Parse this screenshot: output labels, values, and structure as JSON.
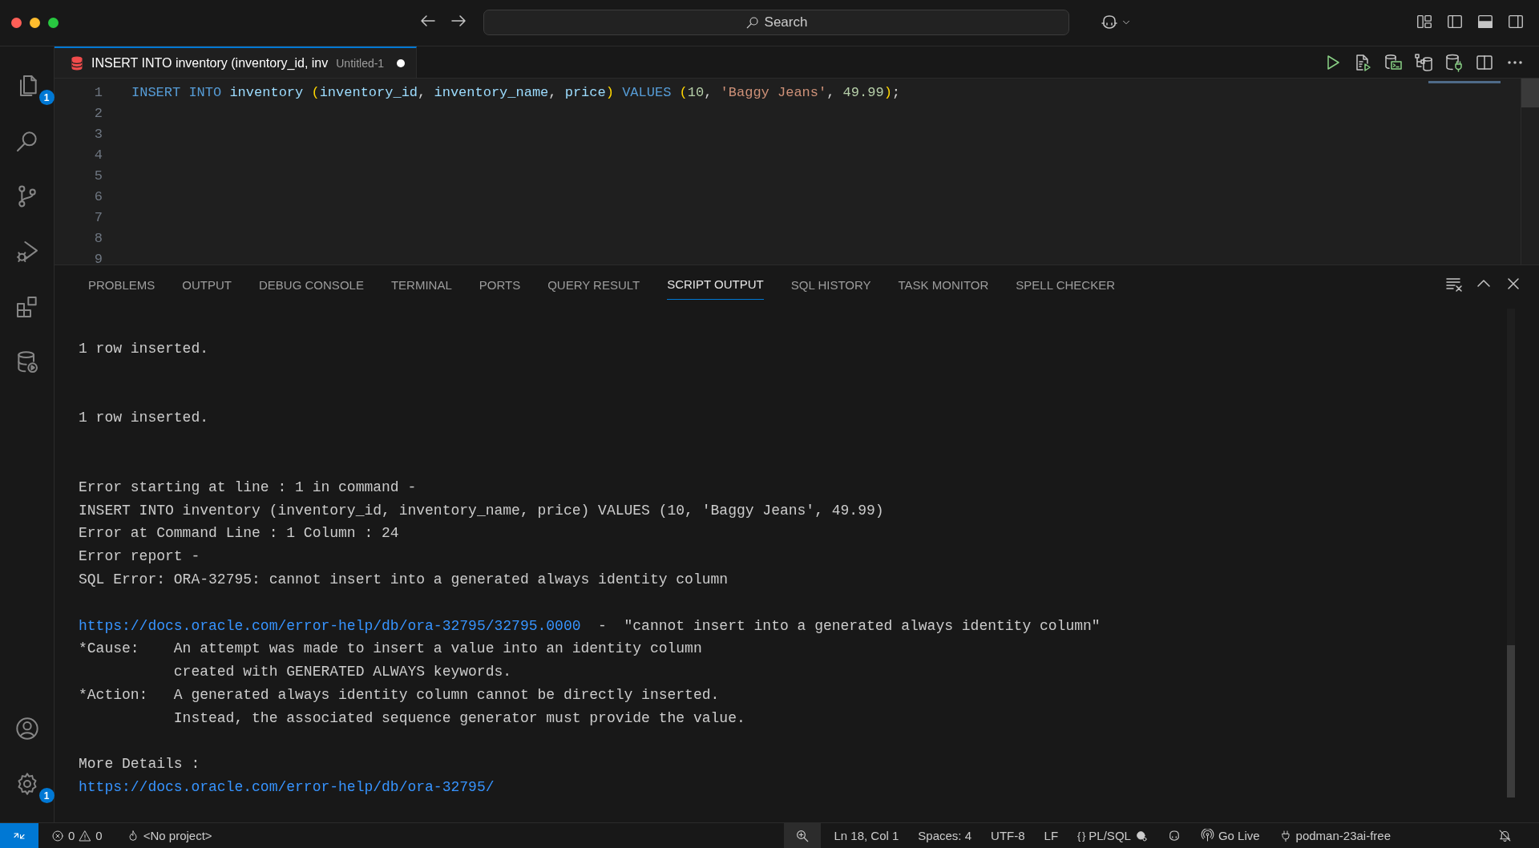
{
  "title_bar": {
    "command_center": "Search"
  },
  "activity_bar": {
    "items": [
      {
        "kind": "explorer",
        "badge": "1"
      },
      {
        "kind": "search"
      },
      {
        "kind": "source_control"
      },
      {
        "kind": "run_debug"
      },
      {
        "kind": "extensions"
      },
      {
        "kind": "database"
      }
    ],
    "bottom_items": [
      {
        "kind": "account"
      },
      {
        "kind": "settings",
        "badge": "1"
      }
    ]
  },
  "editor": {
    "tab": {
      "title": "INSERT INTO inventory (inventory_id, inv",
      "description": "Untitled-1",
      "dirty": true
    },
    "lines": [
      {
        "number": "1",
        "tokens": [
          {
            "kind": "keyword",
            "text": "INSERT INTO "
          },
          {
            "kind": "identifier",
            "text": "inventory "
          },
          {
            "kind": "bracket",
            "text": "("
          },
          {
            "kind": "identifier",
            "text": "inventory_id"
          },
          {
            "kind": "plain",
            "text": ", "
          },
          {
            "kind": "identifier",
            "text": "inventory_name"
          },
          {
            "kind": "plain",
            "text": ", "
          },
          {
            "kind": "identifier",
            "text": "price"
          },
          {
            "kind": "bracket",
            "text": ")"
          },
          {
            "kind": "keyword",
            "text": " VALUES "
          },
          {
            "kind": "bracket",
            "text": "("
          },
          {
            "kind": "number",
            "text": "10"
          },
          {
            "kind": "plain",
            "text": ", "
          },
          {
            "kind": "string",
            "text": "'Baggy Jeans'"
          },
          {
            "kind": "plain",
            "text": ", "
          },
          {
            "kind": "number",
            "text": "49.99"
          },
          {
            "kind": "bracket",
            "text": ")"
          },
          {
            "kind": "plain",
            "text": ";"
          }
        ]
      },
      {
        "number": "2"
      },
      {
        "number": "3"
      },
      {
        "number": "4"
      },
      {
        "number": "5"
      },
      {
        "number": "6"
      },
      {
        "number": "7"
      },
      {
        "number": "8"
      },
      {
        "number": "9"
      }
    ]
  },
  "panel": {
    "tabs": [
      {
        "label": "PROBLEMS",
        "selected": false
      },
      {
        "label": "OUTPUT",
        "selected": false
      },
      {
        "label": "DEBUG CONSOLE",
        "selected": false
      },
      {
        "label": "TERMINAL",
        "selected": false
      },
      {
        "label": "PORTS",
        "selected": false
      },
      {
        "label": "QUERY RESULT",
        "selected": false
      },
      {
        "label": "SCRIPT OUTPUT",
        "selected": true
      },
      {
        "label": "SQL HISTORY",
        "selected": false
      },
      {
        "label": "TASK MONITOR",
        "selected": false
      },
      {
        "label": "SPELL CHECKER",
        "selected": false
      }
    ],
    "output": [
      {
        "kind": "result",
        "lines": [
          {
            "kind": "text",
            "text": "1 row inserted."
          }
        ]
      },
      {
        "kind": "result",
        "lines": [
          {
            "kind": "text",
            "text": "1 row inserted."
          }
        ]
      },
      {
        "kind": "report",
        "lines": [
          {
            "kind": "text",
            "text": "Error starting at line : 1 in command -"
          },
          {
            "kind": "text",
            "text": "INSERT INTO inventory (inventory_id, inventory_name, price) VALUES (10, 'Baggy Jeans', 49.99)"
          },
          {
            "kind": "text",
            "text": "Error at Command Line : 1 Column : 24"
          },
          {
            "kind": "text",
            "text": "Error report -"
          },
          {
            "kind": "text",
            "text": "SQL Error: ORA-32795: cannot insert into a generated always identity column"
          }
        ]
      },
      {
        "kind": "report",
        "lines": [
          {
            "kind": "link",
            "link": "https://docs.oracle.com/error-help/db/ora-32795/32795.0000",
            "separator": "-",
            "text": "\"cannot insert into a generated always identity column\""
          },
          {
            "kind": "field",
            "label": "*Cause:",
            "text": "An attempt was made to insert a value into an identity column"
          },
          {
            "kind": "continuation",
            "text": "created with GENERATED ALWAYS keywords."
          },
          {
            "kind": "field",
            "label": "*Action:",
            "text": "A generated always identity column cannot be directly inserted."
          },
          {
            "kind": "continuation",
            "text": "Instead, the associated sequence generator must provide the value."
          }
        ]
      },
      {
        "kind": "report",
        "lines": [
          {
            "kind": "text",
            "text": "More Details :"
          },
          {
            "kind": "link",
            "link": "https://docs.oracle.com/error-help/db/ora-32795/"
          }
        ]
      }
    ]
  },
  "status_bar": {
    "errors": "0",
    "warnings": "0",
    "project": "<No project>",
    "position": "Ln 18, Col 1",
    "indentation": "Spaces: 4",
    "encoding": "UTF-8",
    "eol": "LF",
    "language_icon": "{ }",
    "language": "PL/SQL",
    "live_server": "Go Live",
    "connection": "podman-23ai-free"
  }
}
